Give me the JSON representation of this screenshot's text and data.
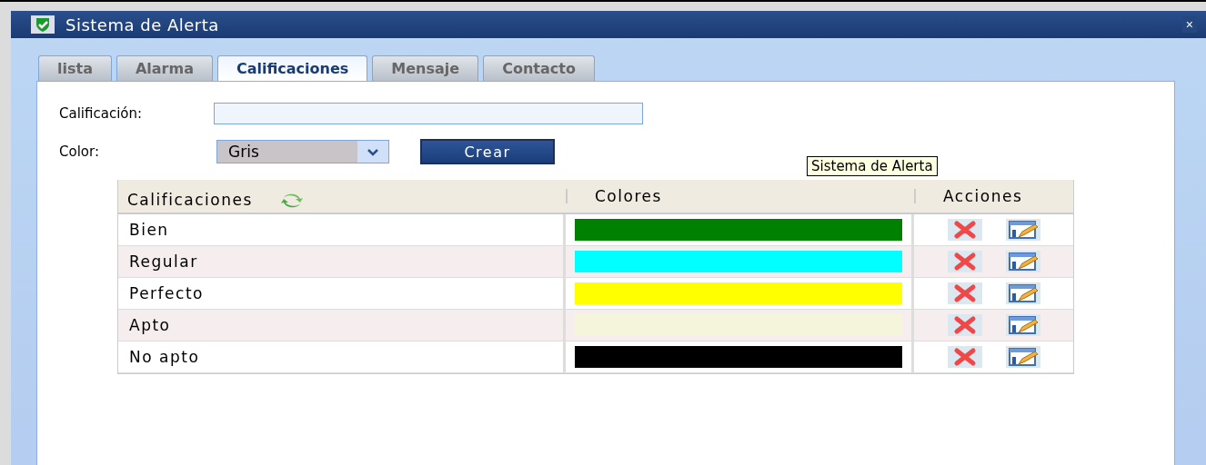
{
  "window": {
    "title": "Sistema de Alerta",
    "close": "×"
  },
  "tabs": [
    {
      "label": "lista",
      "selected": false
    },
    {
      "label": "Alarma",
      "selected": false
    },
    {
      "label": "Calificaciones",
      "selected": true
    },
    {
      "label": "Mensaje",
      "selected": false
    },
    {
      "label": "Contacto",
      "selected": false
    }
  ],
  "form": {
    "rating_label": "Calificación:",
    "color_label": "Color:",
    "color_value": "Gris",
    "create_button": "Crear"
  },
  "tooltip": "Sistema de Alerta",
  "table": {
    "columns": [
      "Calificaciones",
      "Colores",
      "Acciones"
    ],
    "rows": [
      {
        "name": "Bien",
        "color": "#008000"
      },
      {
        "name": "Regular",
        "color": "#00ffff"
      },
      {
        "name": "Perfecto",
        "color": "#ffff00"
      },
      {
        "name": "Apto",
        "color": "#f5f5dc"
      },
      {
        "name": "No apto",
        "color": "#000000"
      }
    ]
  }
}
